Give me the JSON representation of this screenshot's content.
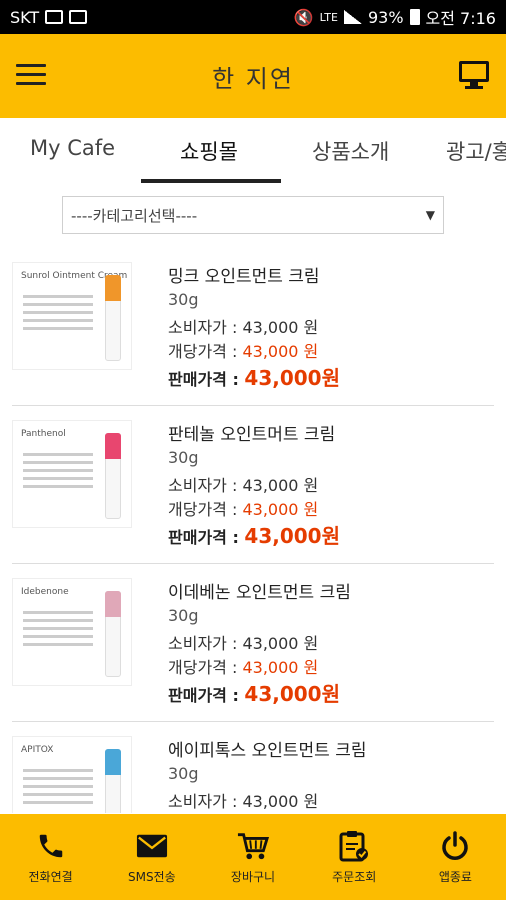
{
  "status_bar": {
    "carrier": "SKT",
    "battery": "93%",
    "time": "오전 7:16",
    "network": "LTE"
  },
  "app_bar": {
    "title": "한 지연",
    "menu_icon": "hamburger-icon",
    "right_icon": "monitor-icon",
    "background": "#fcbc00"
  },
  "tabs": [
    {
      "label": "My Cafe"
    },
    {
      "label": "쇼핑몰",
      "active": true
    },
    {
      "label": "상품소개"
    },
    {
      "label": "광고/홍"
    }
  ],
  "category_select": {
    "value": "----카테고리선택----"
  },
  "products": [
    {
      "name": "밍크 오인트먼트 크림",
      "weight": "30g",
      "consumer_price_label": "소비자가 : ",
      "consumer_price": "43,000 원",
      "dealer_price_label": "개당가격 : ",
      "dealer_price": "43,000 원",
      "sale_price_label": "판매가격 : ",
      "sale_price": "43,000원",
      "thumb_brand": "Sunrol Ointment Cream",
      "thumb_color": "#f0962a"
    },
    {
      "name": "판테놀 오인트머트 크림",
      "weight": "30g",
      "consumer_price_label": "소비자가 : ",
      "consumer_price": "43,000 원",
      "dealer_price_label": "개당가격 : ",
      "dealer_price": "43,000 원",
      "sale_price_label": "판매가격 : ",
      "sale_price": "43,000원",
      "thumb_brand": "Panthenol",
      "thumb_color": "#e8466f"
    },
    {
      "name": "이데베논 오인트먼트 크림",
      "weight": "30g",
      "consumer_price_label": "소비자가 : ",
      "consumer_price": "43,000 원",
      "dealer_price_label": "개당가격 : ",
      "dealer_price": "43,000 원",
      "sale_price_label": "판매가격 : ",
      "sale_price": "43,000원",
      "thumb_brand": "Idebenone",
      "thumb_color": "#e0a8b8"
    },
    {
      "name": "에이피톡스 오인트먼트 크림",
      "weight": "30g",
      "consumer_price_label": "소비자가 : ",
      "consumer_price": "43,000 원",
      "dealer_price_label": "",
      "dealer_price": "",
      "sale_price_label": "",
      "sale_price": "",
      "thumb_brand": "APITOX",
      "thumb_color": "#4aa7d8"
    }
  ],
  "bottom_nav": [
    {
      "label": "전화연결",
      "icon": "phone-icon"
    },
    {
      "label": "SMS전송",
      "icon": "mail-icon"
    },
    {
      "label": "장바구니",
      "icon": "cart-icon"
    },
    {
      "label": "주문조회",
      "icon": "clipboard-icon"
    },
    {
      "label": "앱종료",
      "icon": "power-icon"
    }
  ]
}
